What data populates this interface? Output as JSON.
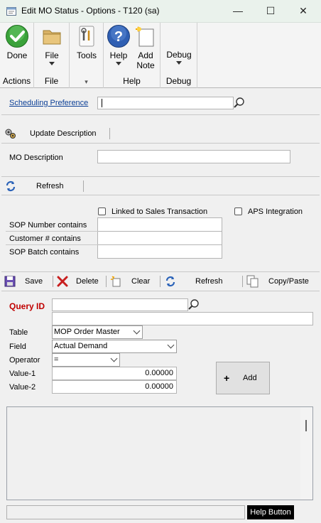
{
  "window": {
    "title": "Edit MO Status - Options  -  T120 (sa)",
    "minimize": "—",
    "maximize": "☐",
    "close": "✕"
  },
  "ribbon": {
    "groups": [
      {
        "label": "Actions",
        "buttons": [
          {
            "label": "Done",
            "icon": "check-circle-icon"
          }
        ]
      },
      {
        "label": "File",
        "buttons": [
          {
            "label": "File",
            "icon": "folder-icon"
          }
        ]
      },
      {
        "label": "",
        "buttons": [
          {
            "label": "Tools",
            "icon": "tools-icon"
          }
        ]
      },
      {
        "label": "Help",
        "buttons": [
          {
            "label": "Help",
            "icon": "help-icon"
          },
          {
            "label": "Add",
            "label2": "Note",
            "icon": "note-icon"
          }
        ]
      },
      {
        "label": "Debug",
        "buttons": [
          {
            "label": "Debug",
            "icon": "debug-icon"
          }
        ]
      }
    ],
    "tools_group_arrow": "▾"
  },
  "scheduling": {
    "label": "Scheduling Preference",
    "value": ""
  },
  "update_description": {
    "label": "Update Description"
  },
  "mo_description": {
    "label": "MO Description",
    "value": ""
  },
  "refresh1": {
    "label": "Refresh"
  },
  "filters": {
    "linked_label": "Linked to Sales Transaction",
    "aps_label": "APS Integration",
    "rows": [
      {
        "label": "SOP Number contains",
        "value": ""
      },
      {
        "label": "Customer # contains",
        "value": ""
      },
      {
        "label": "SOP Batch contains",
        "value": ""
      }
    ]
  },
  "toolbar": {
    "save": "Save",
    "delete": "Delete",
    "clear": "Clear",
    "refresh": "Refresh",
    "copy_paste": "Copy/Paste"
  },
  "query": {
    "id_label": "Query ID",
    "id_value": "",
    "description_value": "",
    "table_label": "Table",
    "table_value": "MOP Order Master",
    "field_label": "Field",
    "field_value": "Actual Demand",
    "operator_label": "Operator",
    "operator_value": "=",
    "value1_label": "Value-1",
    "value1": "0.00000",
    "value2_label": "Value-2",
    "value2": "0.00000",
    "add_symbol": "+",
    "add_label": "Add"
  },
  "status": {
    "text": "",
    "help_button": "Help Button"
  },
  "colors": {
    "accent_red": "#c00000",
    "link_blue": "#0b3f96",
    "help_button_bg": "#000000"
  }
}
